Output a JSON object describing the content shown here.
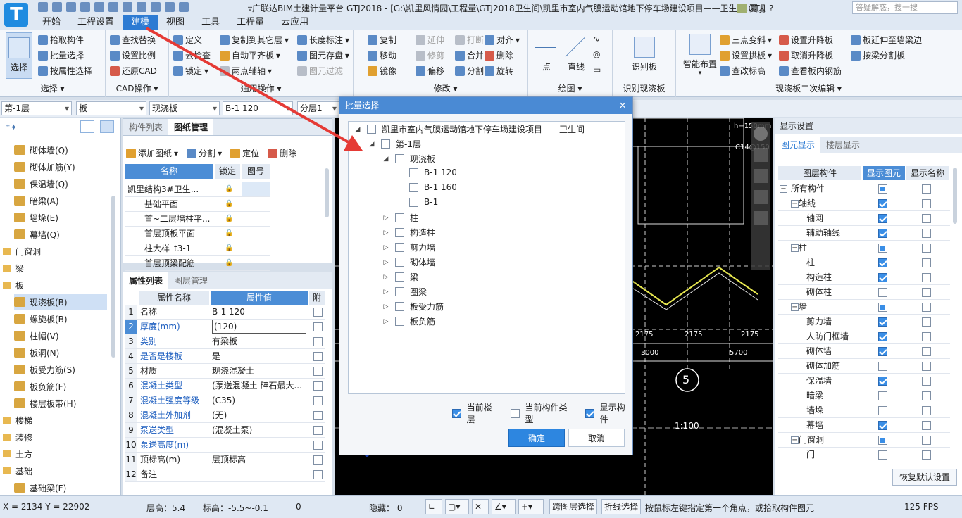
{
  "window": {
    "title": "▿广联达BIM土建计量平台 GTJ2018 - [G:\\凯里风情园\\工程量\\GTJ2018卫生间\\凯里市室内气膜运动馆地下停车场建设项目——卫生间.GTJ]",
    "user": "夏末",
    "search_placeholder": "答疑解惑，搜一搜"
  },
  "menu": [
    "开始",
    "工程设置",
    "建模",
    "视图",
    "工具",
    "工程量",
    "云应用"
  ],
  "ribbon": {
    "select_group": {
      "big": "选择",
      "items": [
        "拾取构件",
        "批量选择",
        "按属性选择"
      ],
      "caption": "选择"
    },
    "cad_group": {
      "items": [
        "查找替换",
        "设置比例",
        "还原CAD"
      ],
      "caption": "CAD操作"
    },
    "common_group": {
      "items": [
        "定义",
        "云检查",
        "锁定",
        "复制到其它层",
        "自动平齐板",
        "两点辅轴",
        "长度标注",
        "图元存盘",
        "图元过滤"
      ],
      "caption": "通用操作"
    },
    "modify_group": {
      "items": [
        "复制",
        "延伸",
        "打断",
        "对齐",
        "移动",
        "修剪",
        "合并",
        "删除",
        "镜像",
        "偏移",
        "分割",
        "旋转"
      ],
      "caption": "修改"
    },
    "draw_group": {
      "items": [
        "点",
        "直线"
      ],
      "caption": "绘图"
    },
    "identify_group": {
      "big": "识别板",
      "caption": "识别现浇板"
    },
    "slab_group": {
      "big": "智能布置",
      "items": [
        "三点变斜",
        "设置拱板",
        "查改标高",
        "设置升降板",
        "取消升降板",
        "查看板内钢筋",
        "板延伸至墙梁边",
        "按梁分割板"
      ],
      "caption": "现浇板二次编辑"
    }
  },
  "selectors": [
    "第-1层",
    "板",
    "现浇板",
    "B-1 120",
    "分层1"
  ],
  "left_tree": [
    {
      "label": "砌体墙(Q)",
      "level": 1
    },
    {
      "label": "砌体加筋(Y)",
      "level": 1
    },
    {
      "label": "保温墙(Q)",
      "level": 1
    },
    {
      "label": "暗梁(A)",
      "level": 1
    },
    {
      "label": "墙垛(E)",
      "level": 1
    },
    {
      "label": "幕墙(Q)",
      "level": 1
    },
    {
      "label": "门窗洞",
      "level": 0
    },
    {
      "label": "梁",
      "level": 0
    },
    {
      "label": "板",
      "level": 0
    },
    {
      "label": "现浇板(B)",
      "level": 1,
      "selected": true
    },
    {
      "label": "螺旋板(B)",
      "level": 1
    },
    {
      "label": "柱帽(V)",
      "level": 1
    },
    {
      "label": "板洞(N)",
      "level": 1
    },
    {
      "label": "板受力筋(S)",
      "level": 1
    },
    {
      "label": "板负筋(F)",
      "level": 1
    },
    {
      "label": "楼层板带(H)",
      "level": 1
    },
    {
      "label": "楼梯",
      "level": 0
    },
    {
      "label": "装修",
      "level": 0
    },
    {
      "label": "土方",
      "level": 0
    },
    {
      "label": "基础",
      "level": 0
    },
    {
      "label": "基础梁(F)",
      "level": 1
    }
  ],
  "drawing_panel": {
    "tabs": [
      "构件列表",
      "图纸管理"
    ],
    "toolbar": [
      "添加图纸",
      "分割",
      "定位",
      "删除"
    ],
    "headers": [
      "名称",
      "锁定",
      "图号"
    ],
    "rows": [
      "凯里结构3#卫生...",
      "基础平面",
      "首~二层墙柱平...",
      "首层顶板平面",
      "柱大样_t3-1",
      "首层顶梁配筋"
    ]
  },
  "property_panel": {
    "tabs": [
      "属性列表",
      "图层管理"
    ],
    "headers": [
      "属性名称",
      "属性值",
      "附"
    ],
    "rows": [
      {
        "n": "1",
        "name": "名称",
        "value": "B-1 120"
      },
      {
        "n": "2",
        "name": "厚度(mm)",
        "value": "(120)"
      },
      {
        "n": "3",
        "name": "类别",
        "value": "有梁板"
      },
      {
        "n": "4",
        "name": "是否是楼板",
        "value": "是"
      },
      {
        "n": "5",
        "name": "材质",
        "value": "现浇混凝土"
      },
      {
        "n": "6",
        "name": "混凝土类型",
        "value": "(泵送混凝土 碎石最大..."
      },
      {
        "n": "7",
        "name": "混凝土强度等级",
        "value": "(C35)"
      },
      {
        "n": "8",
        "name": "混凝土外加剂",
        "value": "(无)"
      },
      {
        "n": "9",
        "name": "泵送类型",
        "value": "(混凝土泵)"
      },
      {
        "n": "10",
        "name": "泵送高度(m)",
        "value": ""
      },
      {
        "n": "11",
        "name": "顶标高(m)",
        "value": "层顶标高"
      },
      {
        "n": "12",
        "name": "备注",
        "value": ""
      }
    ]
  },
  "canvas_labels": {
    "h": "h=150mm",
    "c": "C14@150",
    "d1": "2175",
    "d2": "2175",
    "d3": "2175",
    "d4": "3000",
    "d5": "5700",
    "axis": "5",
    "scale": "1:100"
  },
  "dialog": {
    "title": "批量选择",
    "tree": [
      {
        "label": "凯里市室内气膜运动馆地下停车场建设项目——卫生间",
        "depth": 0,
        "tog": "◢"
      },
      {
        "label": "第-1层",
        "depth": 1,
        "tog": "◢"
      },
      {
        "label": "现浇板",
        "depth": 2,
        "tog": "◢"
      },
      {
        "label": "B-1 120",
        "depth": 3,
        "tog": ""
      },
      {
        "label": "B-1 160",
        "depth": 3,
        "tog": ""
      },
      {
        "label": "B-1",
        "depth": 3,
        "tog": ""
      },
      {
        "label": "柱",
        "depth": 2,
        "tog": "▷"
      },
      {
        "label": "构造柱",
        "depth": 2,
        "tog": "▷"
      },
      {
        "label": "剪力墙",
        "depth": 2,
        "tog": "▷"
      },
      {
        "label": "砌体墙",
        "depth": 2,
        "tog": "▷"
      },
      {
        "label": "梁",
        "depth": 2,
        "tog": "▷"
      },
      {
        "label": "圈梁",
        "depth": 2,
        "tog": "▷"
      },
      {
        "label": "板受力筋",
        "depth": 2,
        "tog": "▷"
      },
      {
        "label": "板负筋",
        "depth": 2,
        "tog": "▷"
      }
    ],
    "options": [
      {
        "label": "当前楼层",
        "checked": true
      },
      {
        "label": "当前构件类型",
        "checked": false
      },
      {
        "label": "显示构件",
        "checked": true
      }
    ],
    "ok": "确定",
    "cancel": "取消"
  },
  "display_settings": {
    "title": "显示设置",
    "tabs": [
      "图元显示",
      "楼层显示"
    ],
    "headers": [
      "图层构件",
      "显示图元",
      "显示名称"
    ],
    "rows": [
      {
        "label": "所有构件",
        "depth": 0,
        "exp": "−",
        "show": "part",
        "name": false
      },
      {
        "label": "轴线",
        "depth": 1,
        "exp": "−",
        "show": "on",
        "name": false
      },
      {
        "label": "轴网",
        "depth": 2,
        "exp": "",
        "show": "on",
        "name": false
      },
      {
        "label": "辅助轴线",
        "depth": 2,
        "exp": "",
        "show": "on",
        "name": false
      },
      {
        "label": "柱",
        "depth": 1,
        "exp": "−",
        "show": "part",
        "name": false
      },
      {
        "label": "柱",
        "depth": 2,
        "exp": "",
        "show": "on",
        "name": false
      },
      {
        "label": "构造柱",
        "depth": 2,
        "exp": "",
        "show": "on",
        "name": false
      },
      {
        "label": "砌体柱",
        "depth": 2,
        "exp": "",
        "show": "off",
        "name": false
      },
      {
        "label": "墙",
        "depth": 1,
        "exp": "−",
        "show": "part",
        "name": false
      },
      {
        "label": "剪力墙",
        "depth": 2,
        "exp": "",
        "show": "on",
        "name": false
      },
      {
        "label": "人防门框墙",
        "depth": 2,
        "exp": "",
        "show": "on",
        "name": false
      },
      {
        "label": "砌体墙",
        "depth": 2,
        "exp": "",
        "show": "on",
        "name": false
      },
      {
        "label": "砌体加筋",
        "depth": 2,
        "exp": "",
        "show": "off",
        "name": false
      },
      {
        "label": "保温墙",
        "depth": 2,
        "exp": "",
        "show": "on",
        "name": false
      },
      {
        "label": "暗梁",
        "depth": 2,
        "exp": "",
        "show": "off",
        "name": false
      },
      {
        "label": "墙垛",
        "depth": 2,
        "exp": "",
        "show": "off",
        "name": false
      },
      {
        "label": "幕墙",
        "depth": 2,
        "exp": "",
        "show": "on",
        "name": false
      },
      {
        "label": "门窗洞",
        "depth": 1,
        "exp": "−",
        "show": "part",
        "name": false
      },
      {
        "label": "门",
        "depth": 2,
        "exp": "",
        "show": "off",
        "name": false
      }
    ],
    "restore": "恢复默认设置"
  },
  "status": {
    "coords": "X = 2134 Y = 22902",
    "floor_height": "层高：5.4",
    "elevation": "标高：-5.5~-0.1",
    "zero": "0",
    "hidden": "隐藏： 0",
    "cross_layer": "跨图层选择",
    "polyline": "折线选择",
    "hint": "按鼠标左键指定第一个角点，或拾取构件图元",
    "fps": "125 FPS"
  }
}
